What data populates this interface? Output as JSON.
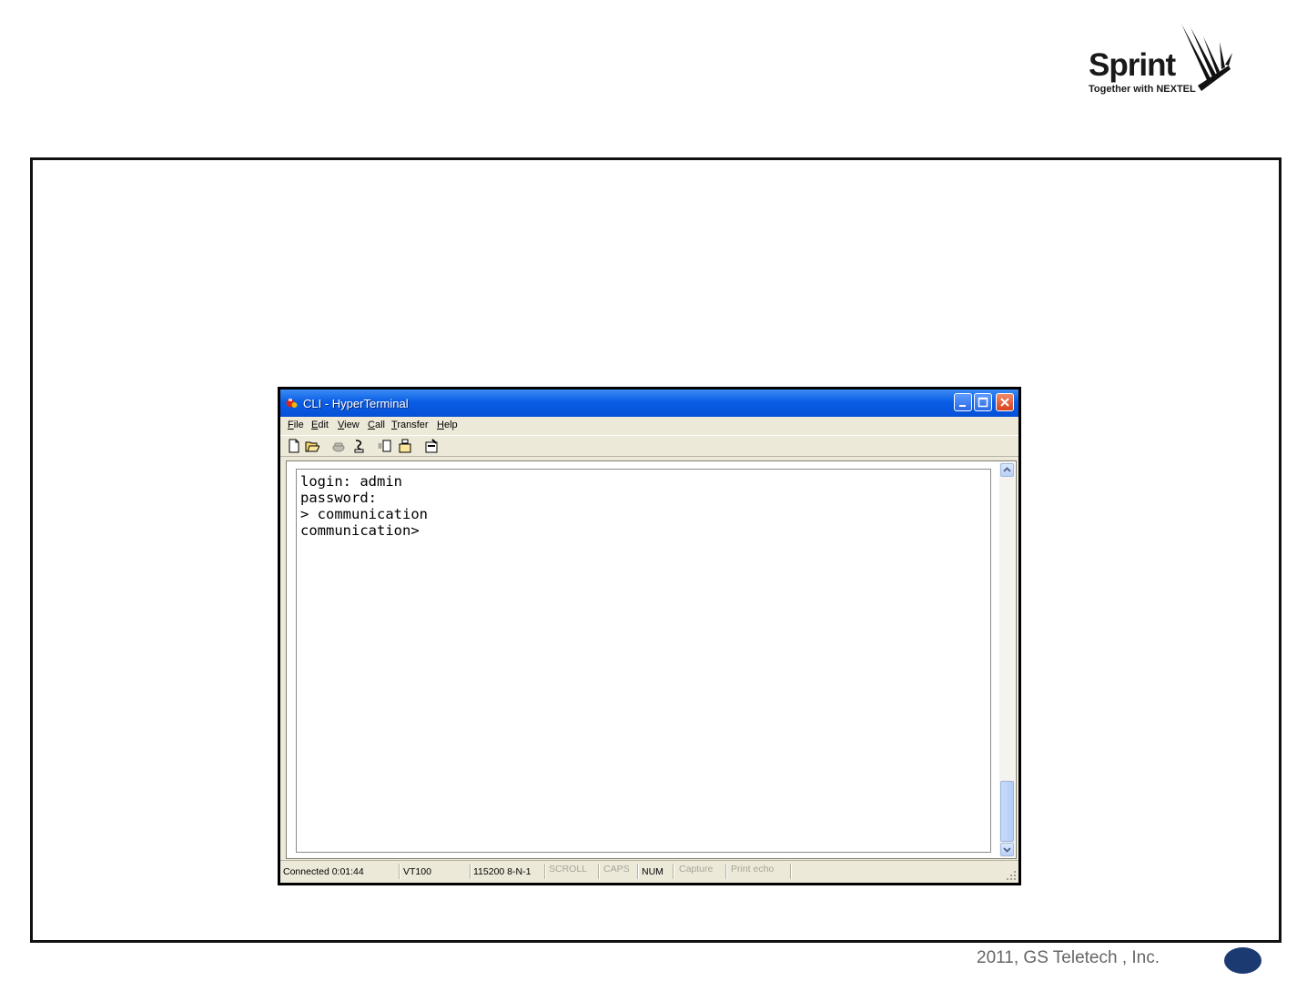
{
  "logo": {
    "word": "Sprint",
    "tagline": "Together with NEXTEL"
  },
  "window": {
    "title": "CLI - HyperTerminal",
    "menu": [
      {
        "mnemonic": "F",
        "rest": "ile"
      },
      {
        "mnemonic": "E",
        "rest": "dit"
      },
      {
        "mnemonic": "V",
        "rest": "iew"
      },
      {
        "mnemonic": "C",
        "rest": "all"
      },
      {
        "mnemonic": "T",
        "rest": "ransfer"
      },
      {
        "mnemonic": "H",
        "rest": "elp"
      }
    ],
    "toolbar_icons": [
      "new-icon",
      "open-icon",
      "disconnect-icon",
      "connect-icon",
      "send-icon",
      "receive-icon",
      "properties-icon"
    ],
    "terminal_lines": [
      "login: admin",
      "password:",
      "> communication",
      "communication>"
    ],
    "status": {
      "connected": "Connected 0:01:44",
      "emulation": "VT100",
      "port_settings": "115200 8-N-1",
      "scroll": "SCROLL",
      "caps": "CAPS",
      "num": "NUM",
      "capture": "Capture",
      "print_echo": "Print echo"
    }
  },
  "footer": {
    "copyright": "2011, GS Teletech , Inc."
  },
  "colors": {
    "titlebar": "#0a5ee6",
    "window_bg": "#ece9d8",
    "page_oval": "#1c3a72"
  }
}
